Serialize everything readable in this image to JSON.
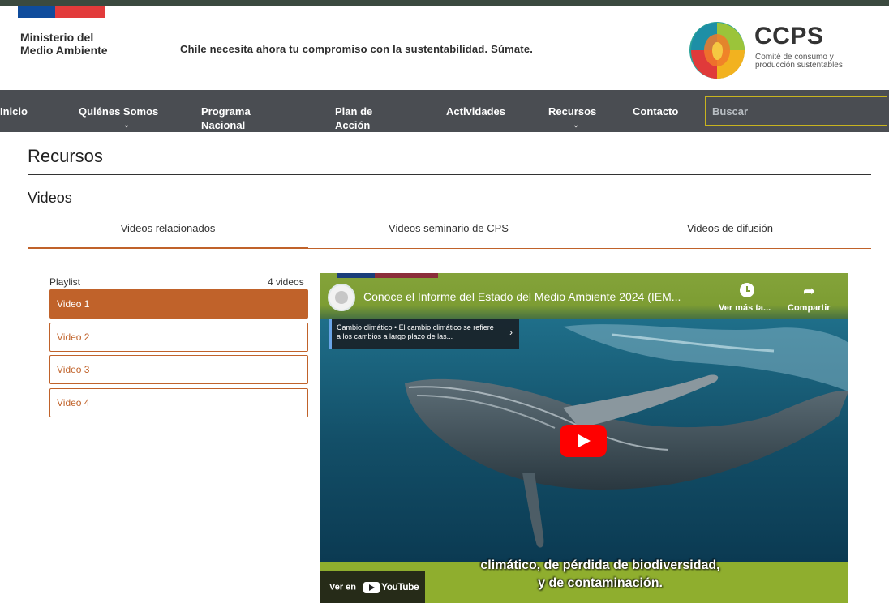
{
  "header": {
    "ministry": "Ministerio del Medio Ambiente",
    "tagline": "Chile necesita ahora tu compromiso con la sustentabilidad. Súmate.",
    "brand": "CCPS",
    "brand_sub": "Comité de consumo y producción sustentables"
  },
  "nav": {
    "items": [
      "Inicio",
      "Quiénes Somos",
      "Programa Nacional",
      "Plan de Acción",
      "Actividades",
      "Recursos",
      "Contacto"
    ],
    "caret": "⌄",
    "search_placeholder": "Buscar"
  },
  "page": {
    "title": "Recursos",
    "section": "Videos",
    "tabs": [
      "Videos relacionados",
      "Videos seminario de CPS",
      "Videos de difusión"
    ]
  },
  "playlist": {
    "label": "Playlist",
    "count": "4 videos",
    "items": [
      "Video 1",
      "Video 2",
      "Video 3",
      "Video 4"
    ]
  },
  "video": {
    "title": "Conoce el Informe del Estado del Medio Ambiente 2024 (IEM...",
    "watch_later": "Ver más ta...",
    "share": "Compartir",
    "chapter": "Cambio climático • El cambio climático se refiere a los cambios a largo plazo de las...",
    "caption_line1": "climático, de pérdida de biodiversidad,",
    "caption_line2": "y de contaminación.",
    "watch_on": "Ver en",
    "youtube": "YouTube"
  },
  "colors": {
    "accent": "#c0622a",
    "nav_bg": "#4a4d52",
    "video_green": "#7d9d33"
  }
}
